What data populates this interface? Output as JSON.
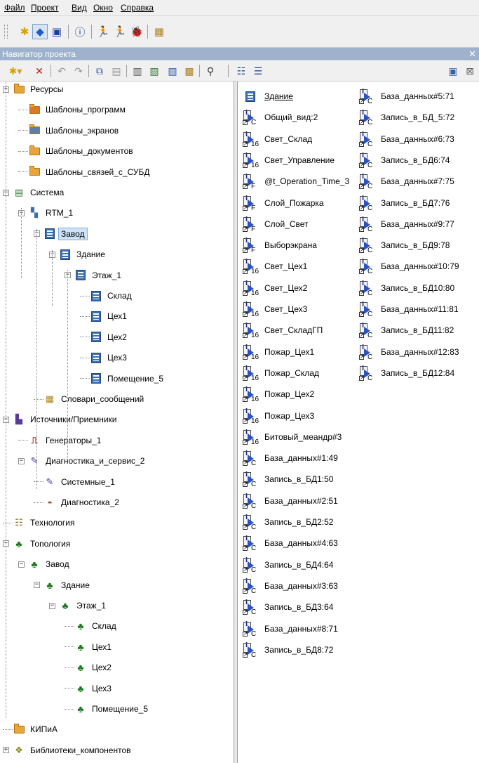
{
  "menu": [
    "Файл",
    "Проект",
    "Вид",
    "Окно",
    "Справка"
  ],
  "panel": {
    "title": "Навигатор проекта",
    "close": "✕"
  },
  "tree": [
    {
      "label": "Ресурсы",
      "icon": "folder-icon",
      "expander": "+"
    },
    {
      "label": "Шаблоны_программ",
      "icon": "template-programs-icon"
    },
    {
      "label": "Шаблоны_экранов",
      "icon": "template-screens-icon"
    },
    {
      "label": "Шаблоны_документов",
      "icon": "template-documents-icon"
    },
    {
      "label": "Шаблоны_связей_с_СУБД",
      "icon": "template-db-links-icon"
    },
    {
      "label": "Система",
      "icon": "system-icon",
      "expander": "−"
    },
    {
      "label": "RTM_1",
      "icon": "rtm-icon",
      "expander": "−"
    },
    {
      "label": "Завод",
      "icon": "group-icon",
      "expander": "−",
      "selected": true
    },
    {
      "label": "Здание",
      "icon": "group-icon",
      "expander": "−"
    },
    {
      "label": "Этаж_1",
      "icon": "group-icon",
      "expander": "−"
    },
    {
      "label": "Склад",
      "icon": "group-icon"
    },
    {
      "label": "Цех1",
      "icon": "group-icon"
    },
    {
      "label": "Цех2",
      "icon": "group-icon"
    },
    {
      "label": "Цех3",
      "icon": "group-icon"
    },
    {
      "label": "Помещение_5",
      "icon": "group-icon"
    },
    {
      "label": "Словари_сообщений",
      "icon": "dictionary-icon"
    },
    {
      "label": "Источники/Приемники",
      "icon": "sources-icon",
      "expander": "−"
    },
    {
      "label": "Генераторы_1",
      "icon": "generator-icon"
    },
    {
      "label": "Диагностика_и_сервис_2",
      "icon": "diagnostics-icon",
      "expander": "−"
    },
    {
      "label": "Системные_1",
      "icon": "system-diag-icon"
    },
    {
      "label": "Диагностика_2",
      "icon": "diag-gauge-icon"
    },
    {
      "label": "Технология",
      "icon": "technology-icon"
    },
    {
      "label": "Топология",
      "icon": "topology-icon",
      "expander": "−"
    },
    {
      "label": "Завод",
      "icon": "topology-node-icon",
      "expander": "−"
    },
    {
      "label": "Здание",
      "icon": "topology-node-icon",
      "expander": "−"
    },
    {
      "label": "Этаж_1",
      "icon": "topology-node-icon",
      "expander": "−"
    },
    {
      "label": "Склад",
      "icon": "topology-node-icon"
    },
    {
      "label": "Цех1",
      "icon": "topology-node-icon"
    },
    {
      "label": "Цех2",
      "icon": "topology-node-icon"
    },
    {
      "label": "Цех3",
      "icon": "topology-node-icon"
    },
    {
      "label": "Помещение_5",
      "icon": "topology-node-icon"
    },
    {
      "label": "КИПиА",
      "icon": "folder-icon"
    },
    {
      "label": "Библиотеки_компонентов",
      "icon": "library-icon",
      "expander": "+"
    }
  ],
  "list_left": [
    {
      "label": "Здание",
      "icon": "group-icon",
      "underline": true
    },
    {
      "label": "Общий_вид:2",
      "icon": "screen-icon",
      "sub": "C"
    },
    {
      "label": "Свет_Склад",
      "icon": "program-icon",
      "sub": "16"
    },
    {
      "label": "Свет_Управление",
      "icon": "program-icon",
      "sub": "16"
    },
    {
      "label": "@t_Operation_Time_3",
      "icon": "program-icon",
      "sub": "F"
    },
    {
      "label": "Слой_Пожарка",
      "icon": "program-icon",
      "sub": "F"
    },
    {
      "label": "Слой_Свет",
      "icon": "program-icon",
      "sub": "F"
    },
    {
      "label": "Выборэкрана",
      "icon": "program-icon",
      "sub": "F"
    },
    {
      "label": "Свет_Цех1",
      "icon": "program-icon",
      "sub": "16"
    },
    {
      "label": "Свет_Цех2",
      "icon": "program-icon",
      "sub": "16"
    },
    {
      "label": "Свет_Цех3",
      "icon": "program-icon",
      "sub": "16"
    },
    {
      "label": "Свет_СкладГП",
      "icon": "program-icon",
      "sub": "16"
    },
    {
      "label": "Пожар_Цех1",
      "icon": "program-icon",
      "sub": "16"
    },
    {
      "label": "Пожар_Склад",
      "icon": "program-icon",
      "sub": "16"
    },
    {
      "label": "Пожар_Цех2",
      "icon": "program-icon",
      "sub": "16"
    },
    {
      "label": "Пожар_Цех3",
      "icon": "program-icon",
      "sub": "16"
    },
    {
      "label": "Битовый_меандр#3",
      "icon": "program-icon",
      "sub": "16"
    },
    {
      "label": "База_данных#1:49",
      "icon": "program-icon",
      "sub": "C"
    },
    {
      "label": "Запись_в_БД1:50",
      "icon": "program-icon",
      "sub": "C"
    },
    {
      "label": "База_данных#2:51",
      "icon": "program-icon",
      "sub": "C"
    },
    {
      "label": "Запись_в_БД2:52",
      "icon": "program-icon",
      "sub": "C"
    },
    {
      "label": "База_данных#4:63",
      "icon": "program-icon",
      "sub": "C"
    },
    {
      "label": "Запись_в_БД4:64",
      "icon": "program-icon",
      "sub": "C"
    },
    {
      "label": "База_данных#3:63",
      "icon": "program-icon",
      "sub": "C"
    },
    {
      "label": "Запись_в_БД3:64",
      "icon": "program-icon",
      "sub": "C"
    },
    {
      "label": "База_данных#8:71",
      "icon": "program-icon",
      "sub": "C"
    },
    {
      "label": "Запись_в_БД8:72",
      "icon": "program-icon",
      "sub": "C"
    }
  ],
  "list_right": [
    {
      "label": "База_данных#5:71",
      "sub": "C"
    },
    {
      "label": "Запись_в_БД_5:72",
      "sub": "C"
    },
    {
      "label": "База_данных#6:73",
      "sub": "C"
    },
    {
      "label": "Запись_в_БД6:74",
      "sub": "C"
    },
    {
      "label": "База_данных#7:75",
      "sub": "C"
    },
    {
      "label": "Запись_в_БД7:76",
      "sub": "C"
    },
    {
      "label": "База_данных#9:77",
      "sub": "C"
    },
    {
      "label": "Запись_в_БД9:78",
      "sub": "C"
    },
    {
      "label": "База_данных#10:79",
      "sub": "C"
    },
    {
      "label": "Запись_в_БД10:80",
      "sub": "C"
    },
    {
      "label": "База_данных#11:81",
      "sub": "C"
    },
    {
      "label": "Запись_в_БД11:82",
      "sub": "C"
    },
    {
      "label": "База_данных#12:83",
      "sub": "C"
    },
    {
      "label": "Запись_в_БД12:84",
      "sub": "C"
    }
  ],
  "colors": {
    "title_bar": "#9eb2cd",
    "selection": "#cfe3f8",
    "program_arrow": "#2a52c8"
  }
}
